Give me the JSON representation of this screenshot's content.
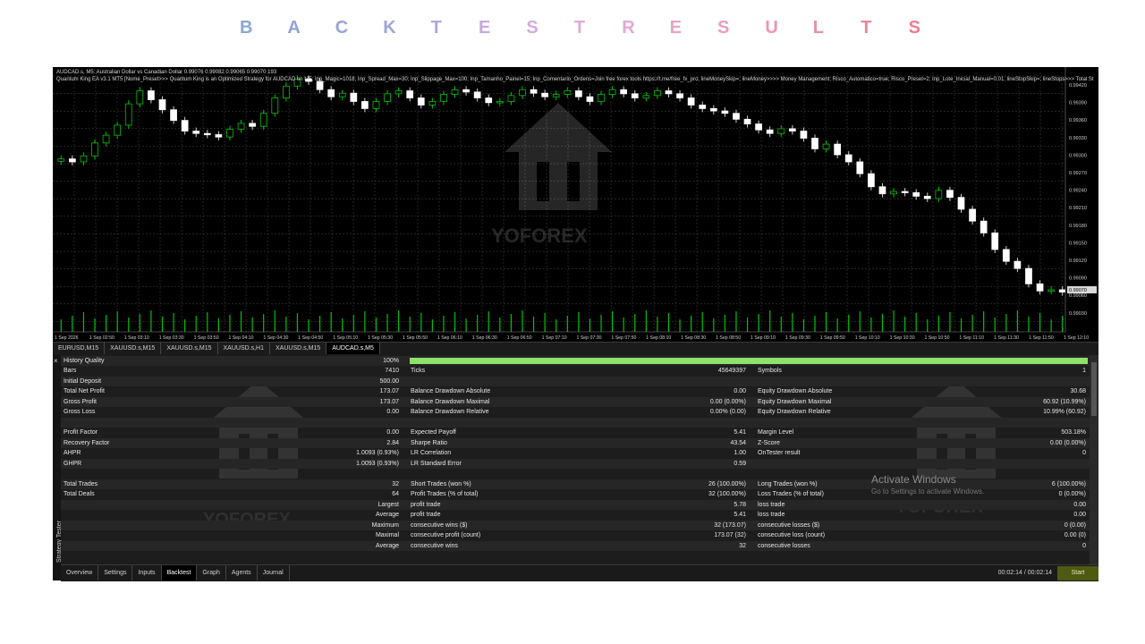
{
  "header": {
    "letters": [
      {
        "ch": "B",
        "color": "#8aa7d6"
      },
      {
        "ch": "A",
        "color": "#8fa3d8"
      },
      {
        "ch": "C",
        "color": "#98a3db"
      },
      {
        "ch": "K",
        "color": "#a1a3dd"
      },
      {
        "ch": "T",
        "color": "#b0a6de"
      },
      {
        "ch": "E",
        "color": "#c5a9e0"
      },
      {
        "ch": "S",
        "color": "#d4abe0"
      },
      {
        "ch": "T",
        "color": "#dfabdb"
      },
      {
        "ch": "R",
        "color": "#e4a8d4"
      },
      {
        "ch": "E",
        "color": "#e6a3c9"
      },
      {
        "ch": "S",
        "color": "#ea9ebe"
      },
      {
        "ch": "U",
        "color": "#ec96b2"
      },
      {
        "ch": "L",
        "color": "#ec8fa6"
      },
      {
        "ch": "T",
        "color": "#ed8799"
      },
      {
        "ch": "S",
        "color": "#ee7f8e"
      }
    ]
  },
  "chart": {
    "info_line1": "AUDCAD.s, M5:  Australian Dollar vs Canadian Dollar  0.99076 0.99082 0.99065 0.99070  193",
    "info_line2": "Quantum King EA v3.1 MT5 [Nome_Preset>>> Quantum King is an Optimized Strategy for AUDCAD on M5; Inp_Magic=1018; Inp_Spread_Max=30; Inp_Slippage_Max=100; Inp_Tamanho_Painel=15; Inp_Comentario_Ordens=Join free forex tools https://t.me/free_fx_pro; lineMoneySkip=; lineMoney>>>> Money Management; Risco_Automatico=true; Risco_Preset=2; Inp_Lote_Inicial_Manual=0.01; lineStopSkip=; lineStops>>> Total St",
    "watermark": "YOFOREX",
    "current_price": "0.99070",
    "price_labels": [
      "0.99420",
      "0.99390",
      "0.99360",
      "0.99330",
      "0.99300",
      "0.99270",
      "0.99240",
      "0.99210",
      "0.99180",
      "0.99150",
      "0.99120",
      "0.99090",
      "0.99060",
      "0.99030"
    ],
    "time_labels": [
      "1 Sep 2026",
      "1 Sep 02:50",
      "1 Sep 03:10",
      "1 Sep 03:30",
      "1 Sep 03:50",
      "1 Sep 04:10",
      "1 Sep 04:30",
      "1 Sep 04:50",
      "1 Sep 05:10",
      "1 Sep 05:30",
      "1 Sep 05:50",
      "1 Sep 06:10",
      "1 Sep 06:30",
      "1 Sep 06:50",
      "1 Sep 07:10",
      "1 Sep 07:30",
      "1 Sep 07:50",
      "1 Sep 08:10",
      "1 Sep 08:30",
      "1 Sep 08:50",
      "1 Sep 09:10",
      "1 Sep 09:30",
      "1 Sep 09:50",
      "1 Sep 10:10",
      "1 Sep 10:30",
      "1 Sep 10:50",
      "1 Sep 11:10",
      "1 Sep 11:30",
      "1 Sep 11:50",
      "1 Sep 12:10"
    ],
    "closes": [
      0.99295,
      0.9929,
      0.993,
      0.99322,
      0.99335,
      0.99352,
      0.99388,
      0.9941,
      0.99395,
      0.99378,
      0.9936,
      0.99342,
      0.99338,
      0.99336,
      0.99332,
      0.99345,
      0.99355,
      0.9935,
      0.99372,
      0.99398,
      0.99418,
      0.9943,
      0.99426,
      0.99412,
      0.994,
      0.99406,
      0.99392,
      0.9938,
      0.99392,
      0.99405,
      0.9941,
      0.99398,
      0.99386,
      0.99392,
      0.99404,
      0.99412,
      0.99408,
      0.99398,
      0.9939,
      0.99392,
      0.99402,
      0.99412,
      0.99406,
      0.994,
      0.99404,
      0.9941,
      0.994,
      0.99392,
      0.99404,
      0.99412,
      0.99405,
      0.99398,
      0.99402,
      0.9941,
      0.99405,
      0.99398,
      0.99386,
      0.9938,
      0.99376,
      0.99372,
      0.99362,
      0.99354,
      0.99344,
      0.99338,
      0.99346,
      0.99342,
      0.9933,
      0.99312,
      0.9932,
      0.99302,
      0.9929,
      0.9927,
      0.99248,
      0.99236,
      0.9924,
      0.99238,
      0.99232,
      0.99228,
      0.99242,
      0.9923,
      0.9921,
      0.9919,
      0.9917,
      0.99142,
      0.99122,
      0.9911,
      0.99084,
      0.99072,
      0.99074,
      0.9907
    ]
  },
  "symbol_tabs": [
    "EURUSD,M15",
    "XAUUSD.s,M15",
    "XAUUSD.s,M15",
    "XAUUSD.s,H1",
    "XAUUSD.s,M15",
    "AUDCAD.s,M5"
  ],
  "tester": {
    "close_glyph": "×",
    "vertical_title": "Strategy Tester",
    "history_quality": {
      "label": "History Quality",
      "value": "100%",
      "fraction": 1.0
    },
    "rows": [
      {
        "c1l": "Bars",
        "c1v": "7410",
        "c2l": "Ticks",
        "c2v": "45649397",
        "c3l": "Symbols",
        "c3v": "1"
      },
      {
        "c1l": "Initial Deposit",
        "c1v": "500.00",
        "c2l": "",
        "c2v": "",
        "c3l": "",
        "c3v": ""
      },
      {
        "c1l": "Total Net Profit",
        "c1v": "173.07",
        "c2l": "Balance Drawdown Absolute",
        "c2v": "0.00",
        "c3l": "Equity Drawdown Absolute",
        "c3v": "30.68"
      },
      {
        "c1l": "Gross Profit",
        "c1v": "173.07",
        "c2l": "Balance Drawdown Maximal",
        "c2v": "0.00 (0.00%)",
        "c3l": "Equity Drawdown Maximal",
        "c3v": "60.92 (10.99%)"
      },
      {
        "c1l": "Gross Loss",
        "c1v": "0.00",
        "c2l": "Balance Drawdown Relative",
        "c2v": "0.00% (0.00)",
        "c3l": "Equity Drawdown Relative",
        "c3v": "10.99% (60.92)"
      },
      {
        "c1l": "",
        "c1v": "",
        "c2l": "",
        "c2v": "",
        "c3l": "",
        "c3v": ""
      },
      {
        "c1l": "Profit Factor",
        "c1v": "0.00",
        "c2l": "Expected Payoff",
        "c2v": "5.41",
        "c3l": "Margin Level",
        "c3v": "503.18%"
      },
      {
        "c1l": "Recovery Factor",
        "c1v": "2.84",
        "c2l": "Sharpe Ratio",
        "c2v": "43.54",
        "c3l": "Z-Score",
        "c3v": "0.00 (0.00%)"
      },
      {
        "c1l": "AHPR",
        "c1v": "1.0093 (0.93%)",
        "c2l": "LR Correlation",
        "c2v": "1.00",
        "c3l": "OnTester result",
        "c3v": "0"
      },
      {
        "c1l": "GHPR",
        "c1v": "1.0093 (0.93%)",
        "c2l": "LR Standard Error",
        "c2v": "0.59",
        "c3l": "",
        "c3v": ""
      },
      {
        "c1l": "",
        "c1v": "",
        "c2l": "",
        "c2v": "",
        "c3l": "",
        "c3v": ""
      },
      {
        "c1l": "Total Trades",
        "c1v": "32",
        "c2l": "Short Trades (won %)",
        "c2v": "26 (100.00%)",
        "c3l": "Long Trades (won %)",
        "c3v": "6 (100.00%)"
      },
      {
        "c1l": "Total Deals",
        "c1v": "64",
        "c2l": "Profit Trades (% of total)",
        "c2v": "32 (100.00%)",
        "c3l": "Loss Trades (% of total)",
        "c3v": "0 (0.00%)"
      },
      {
        "c1l": "",
        "c1v": "Largest",
        "c2l": "profit trade",
        "c2v": "5.78",
        "c3l": "loss trade",
        "c3v": "0.00"
      },
      {
        "c1l": "",
        "c1v": "Average",
        "c2l": "profit trade",
        "c2v": "5.41",
        "c3l": "loss trade",
        "c3v": "0.00"
      },
      {
        "c1l": "",
        "c1v": "Maximum",
        "c2l": "consecutive wins ($)",
        "c2v": "32 (173.07)",
        "c3l": "consecutive losses ($)",
        "c3v": "0 (0.00)"
      },
      {
        "c1l": "",
        "c1v": "Maximal",
        "c2l": "consecutive profit (count)",
        "c2v": "173.07 (32)",
        "c3l": "consecutive loss (count)",
        "c3v": "0.00 (0)"
      },
      {
        "c1l": "",
        "c1v": "Average",
        "c2l": "consecutive wins",
        "c2v": "32",
        "c3l": "consecutive losses",
        "c3v": "0"
      }
    ],
    "bottom_tabs": [
      "Overview",
      "Settings",
      "Inputs",
      "Backtest",
      "Graph",
      "Agents",
      "Journal"
    ],
    "active_tab": "Backtest",
    "timer": "00:02:14 / 00:02:14",
    "start_label": "Start",
    "watermark": "YOFOREX"
  },
  "activate_windows": {
    "title": "Activate Windows",
    "subtitle": "Go to Settings to activate Windows."
  },
  "colors": {
    "bull": "#00c400",
    "bear": "#ffffff",
    "grid": "#4a4a4a",
    "volume": "#00c400",
    "history_bar": "#8ee26b",
    "start_button": "#4e5a12"
  }
}
